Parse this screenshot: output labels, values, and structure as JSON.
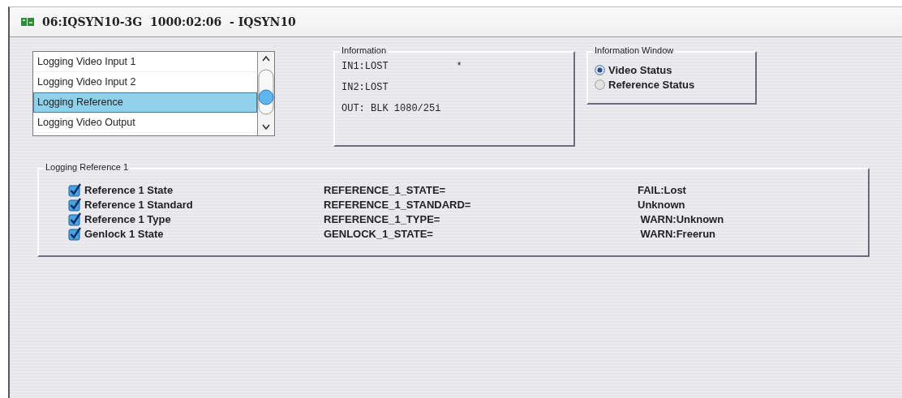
{
  "window": {
    "title": "06:IQSYN10-3G  1000:02:06  - IQSYN10"
  },
  "log_list": {
    "items": [
      {
        "label": "Logging Video Input 1",
        "selected": false
      },
      {
        "label": "Logging Video Input 2",
        "selected": false
      },
      {
        "label": "Logging Reference",
        "selected": true
      },
      {
        "label": "Logging Video Output",
        "selected": false
      }
    ]
  },
  "information": {
    "title": "Information",
    "lines": [
      {
        "text": "IN1:LOST",
        "mark": "*"
      },
      {
        "text": "IN2:LOST"
      },
      {
        "text": "OUT: BLK 1080/25i"
      }
    ]
  },
  "information_window": {
    "title": "Information Window",
    "options": [
      {
        "label": "Video Status",
        "selected": true
      },
      {
        "label": "Reference Status",
        "selected": false
      }
    ]
  },
  "logging_reference": {
    "title": "Logging Reference 1",
    "rows": [
      {
        "label": "Reference **1** State",
        "checked": true,
        "key": "REFERENCE_1_STATE=",
        "value": "FAIL:Lost"
      },
      {
        "label": "Reference **1** Standard",
        "checked": true,
        "key": "REFERENCE_1_STANDARD=",
        "value": "Unknown"
      },
      {
        "label": "Reference **1** Type",
        "checked": true,
        "key": "REFERENCE_1_TYPE=",
        "value": " WARN:Unknown"
      },
      {
        "label": "Genlock **1** State",
        "checked": true,
        "key": "GENLOCK_1_STATE=",
        "value": " WARN:Freerun"
      }
    ]
  }
}
